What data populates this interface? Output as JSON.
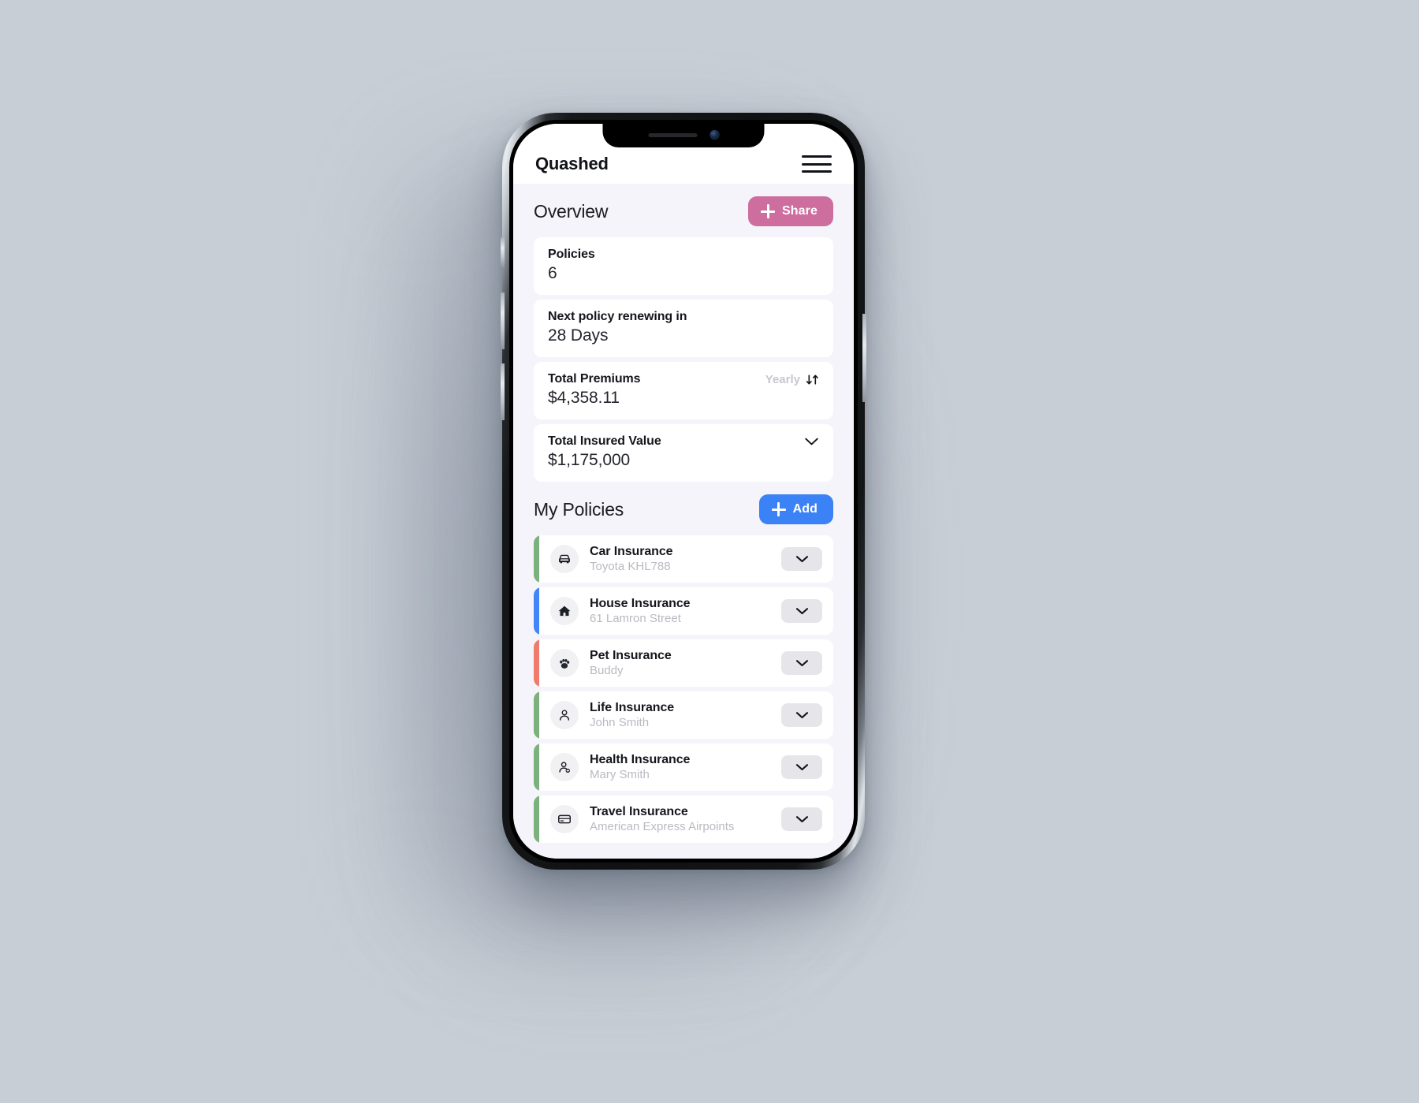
{
  "app": {
    "brand": "Quashed",
    "menu_icon": "hamburger-icon"
  },
  "overview": {
    "title": "Overview",
    "share_label": "Share",
    "cards": [
      {
        "label": "Policies",
        "value": "6",
        "aux": null,
        "aux_icon": null
      },
      {
        "label": "Next policy renewing in",
        "value": "28 Days",
        "aux": null,
        "aux_icon": null
      },
      {
        "label": "Total Premiums",
        "value": "$4,358.11",
        "aux": "Yearly",
        "aux_icon": "sort-icon"
      },
      {
        "label": "Total Insured Value",
        "value": "$1,175,000",
        "aux": "",
        "aux_icon": "chevron-down-icon"
      }
    ]
  },
  "policies_section": {
    "title": "My Policies",
    "add_label": "Add",
    "items": [
      {
        "title": "Car Insurance",
        "subtitle": "Toyota KHL788",
        "icon": "car-icon",
        "accent": "#7cb07c"
      },
      {
        "title": "House Insurance",
        "subtitle": "61 Lamron Street",
        "icon": "house-icon",
        "accent": "#4285f4"
      },
      {
        "title": "Pet Insurance",
        "subtitle": "Buddy",
        "icon": "paw-icon",
        "accent": "#ef7b6c"
      },
      {
        "title": "Life Insurance",
        "subtitle": "John Smith",
        "icon": "person-icon",
        "accent": "#7cb07c"
      },
      {
        "title": "Health Insurance",
        "subtitle": "Mary Smith",
        "icon": "person-add-icon",
        "accent": "#7cb07c"
      },
      {
        "title": "Travel Insurance",
        "subtitle": "American Express Airpoints",
        "icon": "card-icon",
        "accent": "#7cb07c"
      }
    ],
    "expand_icon": "chevron-down-icon"
  },
  "colors": {
    "backdrop": "#c8ced6",
    "app_background": "#f5f4fb",
    "card": "#ffffff",
    "share_pink": "#cd6e9e",
    "add_blue": "#3b82f6",
    "muted_text": "#b9b9c2"
  }
}
